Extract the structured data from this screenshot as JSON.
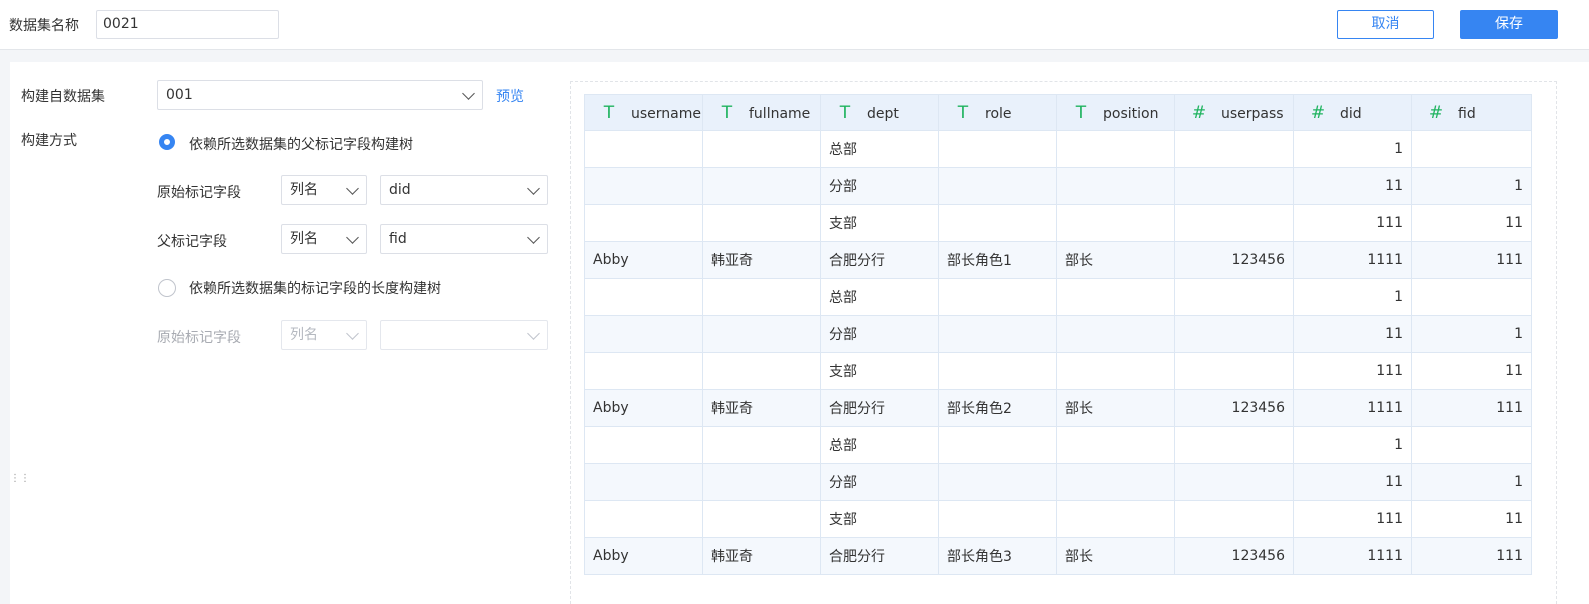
{
  "header": {
    "dataset_name_label": "数据集名称",
    "dataset_name_value": "0021",
    "cancel_label": "取消",
    "save_label": "保存"
  },
  "form": {
    "source_label": "构建自数据集",
    "source_value": "001",
    "preview_label": "预览",
    "method_label": "构建方式",
    "option1_label": "依赖所选数据集的父标记字段构建树",
    "option1_checked": true,
    "orig_field_label": "原始标记字段",
    "orig_field_type": "列名",
    "orig_field_value": "did",
    "parent_field_label": "父标记字段",
    "parent_field_type": "列名",
    "parent_field_value": "fid",
    "option2_label": "依赖所选数据集的标记字段的长度构建树",
    "option2_checked": false,
    "orig_field2_label": "原始标记字段",
    "orig_field2_type": "列名",
    "orig_field2_value": ""
  },
  "table": {
    "columns": [
      {
        "name": "username",
        "type": "T"
      },
      {
        "name": "fullname",
        "type": "T"
      },
      {
        "name": "dept",
        "type": "T"
      },
      {
        "name": "role",
        "type": "T"
      },
      {
        "name": "position",
        "type": "T"
      },
      {
        "name": "userpass",
        "type": "#"
      },
      {
        "name": "did",
        "type": "#"
      },
      {
        "name": "fid",
        "type": "#"
      }
    ],
    "rows": [
      [
        "",
        "",
        "总部",
        "",
        "",
        "",
        "1",
        ""
      ],
      [
        "",
        "",
        "分部",
        "",
        "",
        "",
        "11",
        "1"
      ],
      [
        "",
        "",
        "支部",
        "",
        "",
        "",
        "111",
        "11"
      ],
      [
        "Abby",
        "韩亚奇",
        "合肥分行",
        "部长角色1",
        "部长",
        "123456",
        "1111",
        "111"
      ],
      [
        "",
        "",
        "总部",
        "",
        "",
        "",
        "1",
        ""
      ],
      [
        "",
        "",
        "分部",
        "",
        "",
        "",
        "11",
        "1"
      ],
      [
        "",
        "",
        "支部",
        "",
        "",
        "",
        "111",
        "11"
      ],
      [
        "Abby",
        "韩亚奇",
        "合肥分行",
        "部长角色2",
        "部长",
        "123456",
        "1111",
        "111"
      ],
      [
        "",
        "",
        "总部",
        "",
        "",
        "",
        "1",
        ""
      ],
      [
        "",
        "",
        "分部",
        "",
        "",
        "",
        "11",
        "1"
      ],
      [
        "",
        "",
        "支部",
        "",
        "",
        "",
        "111",
        "11"
      ],
      [
        "Abby",
        "韩亚奇",
        "合肥分行",
        "部长角色3",
        "部长",
        "123456",
        "1111",
        "111"
      ]
    ]
  },
  "colors": {
    "accent": "#3685f2",
    "type_icon": "#1fb35f",
    "header_bg": "#e9f1fb",
    "alt_row_bg": "#f4f8fd"
  }
}
